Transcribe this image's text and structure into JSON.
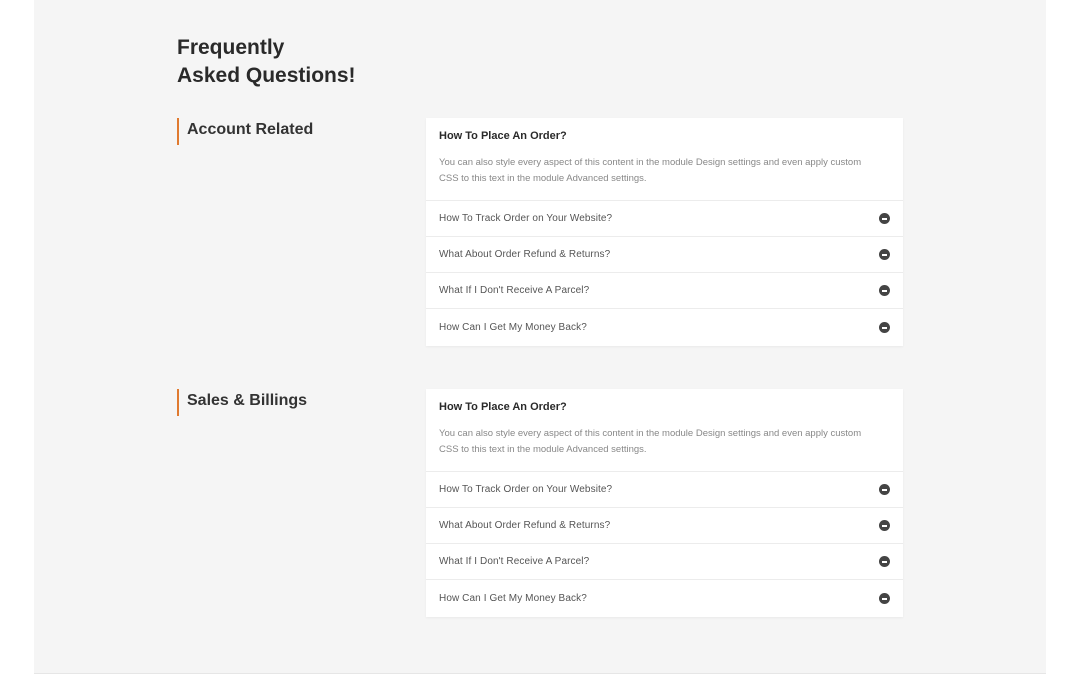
{
  "page": {
    "title_line1": "Frequently",
    "title_line2": "Asked Questions!"
  },
  "sections": [
    {
      "heading": "Account Related",
      "open_item": {
        "question": "How To Place An Order?",
        "answer": "You can also style every aspect of this content in the module Design settings and even apply custom CSS to this text in the module Advanced settings."
      },
      "items": [
        "How To Track Order on Your Website?",
        "What About Order Refund & Returns?",
        "What If I Don't Receive A Parcel?",
        "How Can I Get My Money Back?"
      ]
    },
    {
      "heading": "Sales & Billings",
      "open_item": {
        "question": "How To Place An Order?",
        "answer": "You can also style every aspect of this content in the module Design settings and even apply custom CSS to this text in the module Advanced settings."
      },
      "items": [
        "How To Track Order on Your Website?",
        "What About Order Refund & Returns?",
        "What If I Don't Receive A Parcel?",
        "How Can I Get My Money Back?"
      ]
    }
  ],
  "colors": {
    "accent": "#e07a2f",
    "background": "#f5f5f5",
    "card": "#ffffff",
    "icon": "#444444"
  },
  "icons": {
    "item_toggle": "minus-circle-icon"
  }
}
